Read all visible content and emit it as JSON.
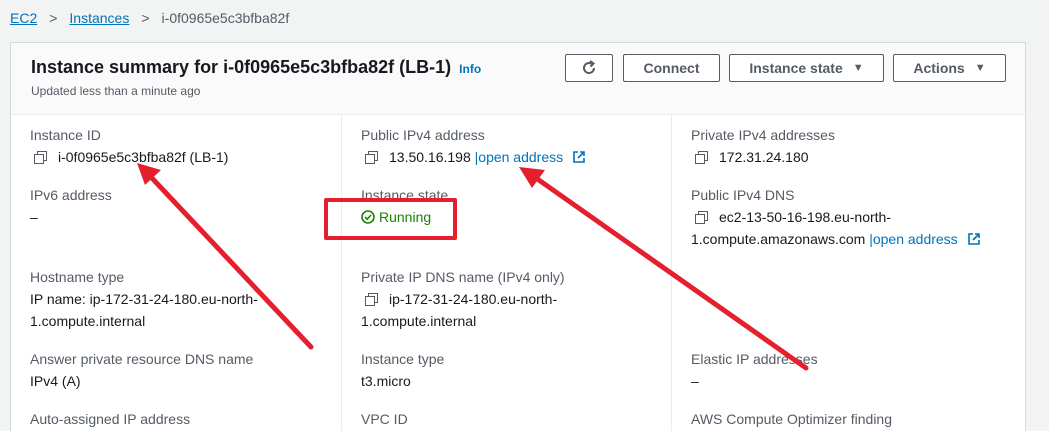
{
  "breadcrumb": {
    "items": [
      "EC2",
      "Instances"
    ],
    "current": "i-0f0965e5c3bfba82f",
    "separator": ">"
  },
  "header": {
    "title": "Instance summary for i-0f0965e5c3bfba82f (LB-1)",
    "info": "Info",
    "updated": "Updated less than a minute ago"
  },
  "buttons": {
    "refresh_icon": "refresh-icon",
    "connect": "Connect",
    "instance_state": "Instance state",
    "actions": "Actions"
  },
  "fields": {
    "instance_id_label": "Instance ID",
    "instance_id_value": "i-0f0965e5c3bfba82f (LB-1)",
    "public_ipv4_label": "Public IPv4 address",
    "public_ipv4_value": "13.50.16.198",
    "public_ipv4_link": "|open address",
    "private_ipv4_label": "Private IPv4 addresses",
    "private_ipv4_value": "172.31.24.180",
    "ipv6_label": "IPv6 address",
    "ipv6_value": "–",
    "instance_state_label": "Instance state",
    "instance_state_value": "Running",
    "public_dns_label": "Public IPv4 DNS",
    "public_dns_line1": "ec2-13-50-16-198.eu-north-",
    "public_dns_line2": "1.compute.amazonaws.com",
    "public_dns_link": "|open address",
    "hostname_type_label": "Hostname type",
    "hostname_type_line1": "IP name: ip-172-31-24-180.eu-north-",
    "hostname_type_line2": "1.compute.internal",
    "private_dns_label": "Private IP DNS name (IPv4 only)",
    "private_dns_line1": "ip-172-31-24-180.eu-north-",
    "private_dns_line2": "1.compute.internal",
    "answer_dns_label": "Answer private resource DNS name",
    "answer_dns_value": "IPv4 (A)",
    "instance_type_label": "Instance type",
    "instance_type_value": "t3.micro",
    "elastic_ip_label": "Elastic IP addresses",
    "elastic_ip_value": "–",
    "auto_ip_label": "Auto-assigned IP address",
    "vpc_label": "VPC ID",
    "optimizer_label": "AWS Compute Optimizer finding"
  },
  "colors": {
    "link": "#0073bb",
    "running": "#1d8102",
    "annotation": "#e5202e"
  }
}
